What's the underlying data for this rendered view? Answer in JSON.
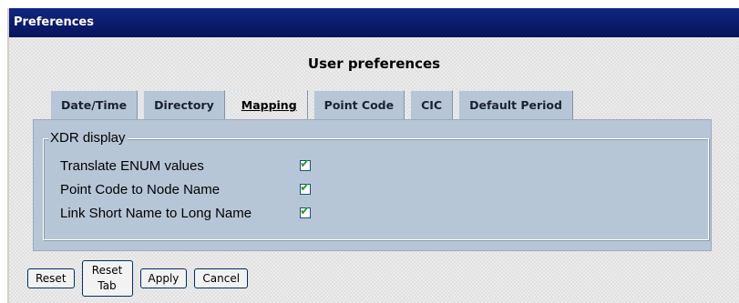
{
  "window": {
    "title": "Preferences"
  },
  "main": {
    "heading": "User preferences"
  },
  "tabs": [
    {
      "label": "Date/Time",
      "active": false
    },
    {
      "label": "Directory",
      "active": false
    },
    {
      "label": "Mapping",
      "active": true
    },
    {
      "label": "Point Code",
      "active": false
    },
    {
      "label": "CIC",
      "active": false
    },
    {
      "label": "Default Period",
      "active": false
    }
  ],
  "xdr_display": {
    "legend": "XDR display",
    "options": [
      {
        "label": "Translate ENUM values",
        "checked": true
      },
      {
        "label": "Point Code to Node Name",
        "checked": true
      },
      {
        "label": "Link Short Name to Long Name",
        "checked": true
      }
    ]
  },
  "buttons": {
    "reset": "Reset",
    "reset_tab": "Reset\nTab",
    "apply": "Apply",
    "cancel": "Cancel"
  },
  "colors": {
    "titlebar": "#0a1a6e",
    "tab": "#b7c6d6",
    "check": "#21a121"
  }
}
